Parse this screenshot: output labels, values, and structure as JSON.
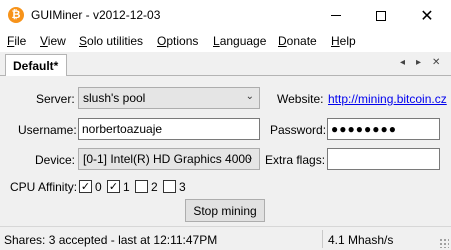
{
  "window": {
    "title": "GUIMiner - v2012-12-03",
    "icon": "bitcoin-icon",
    "icon_glyph": "₿"
  },
  "menu": {
    "file": {
      "accel": "F",
      "rest": "ile"
    },
    "view": {
      "accel": "V",
      "rest": "iew"
    },
    "solo": {
      "accel": "S",
      "rest": "olo utilities"
    },
    "options": {
      "accel": "O",
      "rest": "ptions"
    },
    "language": {
      "accel": "L",
      "rest": "anguage"
    },
    "donate": {
      "accel": "D",
      "rest": "onate"
    },
    "help": {
      "accel": "H",
      "rest": "elp"
    }
  },
  "tabs": {
    "active": "Default*",
    "controls": {
      "left": "◂",
      "right": "▸",
      "close": "✕"
    }
  },
  "form": {
    "server_label": "Server:",
    "server_value": "slush's pool",
    "website_label": "Website:",
    "website_url": "http://mining.bitcoin.cz",
    "username_label": "Username:",
    "username_value": "norbertoazuaje",
    "password_label": "Password:",
    "password_value": "●●●●●●●●",
    "device_label": "Device:",
    "device_value": "[0-1] Intel(R) HD Graphics 4000",
    "extra_flags_label": "Extra flags:",
    "extra_flags_value": "",
    "cpu_affinity_label": "CPU Affinity:",
    "cpu_affinity": [
      {
        "label": "0",
        "checked": true
      },
      {
        "label": "1",
        "checked": true
      },
      {
        "label": "2",
        "checked": false
      },
      {
        "label": "3",
        "checked": false
      }
    ],
    "stop_button": "Stop mining"
  },
  "status": {
    "shares": "Shares: 3 accepted - last at 12:11:47PM",
    "rate": "4.1 Mhash/s"
  },
  "colors": {
    "accent": "#f7931a",
    "link": "#0000ee",
    "panel_bg": "#f0f0f0"
  }
}
